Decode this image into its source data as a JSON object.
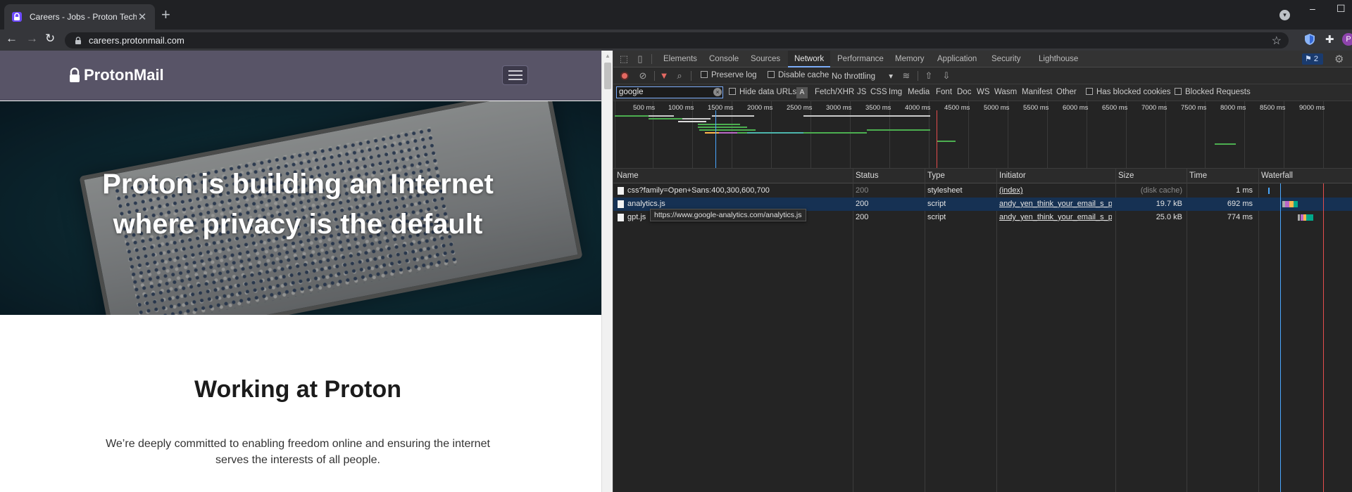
{
  "browser": {
    "tab_title": "Careers - Jobs - Proton Technolo",
    "close_glyph": "✕",
    "newtab_glyph": "+",
    "url": "careers.protonmail.com",
    "profile_initial": "P",
    "extension_badge": "P"
  },
  "site": {
    "logo_text": "ProtonMail",
    "hero_line1": "Proton is building an Internet",
    "hero_line2": "where privacy is the default",
    "section_title": "Working at Proton",
    "section_body": "We’re deeply committed to enabling freedom online and ensuring the internet serves the interests of all people."
  },
  "devtools": {
    "tabs": [
      "Elements",
      "Console",
      "Sources",
      "Network",
      "Performance",
      "Memory",
      "Application",
      "Security",
      "Lighthouse"
    ],
    "active_tab": "Network",
    "issues_count": "2",
    "preserve_log": "Preserve log",
    "disable_cache": "Disable cache",
    "throttling": "No throttling",
    "filter_value": "google",
    "filter_clear": "×",
    "hide_data_urls": "Hide data URLs",
    "aa_label": "A",
    "type_filters": [
      "Fetch/XHR",
      "JS",
      "CSS",
      "Img",
      "Media",
      "Font",
      "Doc",
      "WS",
      "Wasm",
      "Manifest",
      "Other"
    ],
    "has_blocked_cookies": "Has blocked cookies",
    "blocked_requests": "Blocked Requests",
    "timeline_ticks": [
      "500 ms",
      "1000 ms",
      "1500 ms",
      "2000 ms",
      "2500 ms",
      "3000 ms",
      "3500 ms",
      "4000 ms",
      "4500 ms",
      "5000 ms",
      "5500 ms",
      "6000 ms",
      "6500 ms",
      "7000 ms",
      "7500 ms",
      "8000 ms",
      "8500 ms",
      "9000 ms"
    ],
    "columns": [
      "Name",
      "Status",
      "Type",
      "Initiator",
      "Size",
      "Time",
      "Waterfall"
    ],
    "rows": [
      {
        "name": "css?family=Open+Sans:400,300,600,700",
        "status": "200",
        "type": "stylesheet",
        "initiator": "(index)",
        "size": "(disk cache)",
        "time": "1 ms"
      },
      {
        "name": "analytics.js",
        "status": "200",
        "type": "script",
        "initiator": "andy_yen_think_your_email_s_pr...",
        "size": "19.7 kB",
        "time": "692 ms"
      },
      {
        "name": "gpt.js",
        "status": "200",
        "type": "script",
        "initiator": "andy_yen_think_your_email_s_pr...",
        "size": "25.0 kB",
        "time": "774 ms"
      }
    ],
    "tooltip": "https://www.google-analytics.com/analytics.js"
  },
  "colors": {
    "accent": "#7cacf8",
    "header_bg": "#585467",
    "record_red": "#e46962"
  }
}
